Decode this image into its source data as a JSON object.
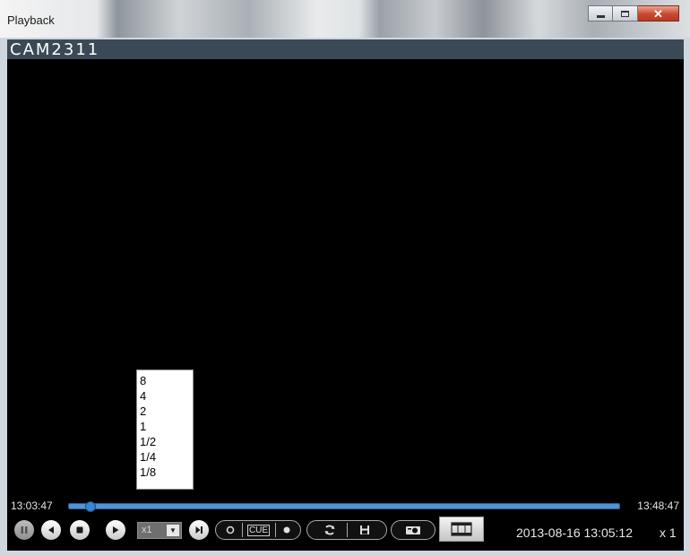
{
  "window": {
    "title": "Playback"
  },
  "camera": {
    "name": "CAM2311"
  },
  "speed_menu": {
    "options": [
      "8",
      "4",
      "2",
      "1",
      "1/2",
      "1/4",
      "1/8"
    ]
  },
  "timeline": {
    "start": "13:03:47",
    "end": "13:48:47",
    "progress": 0.04
  },
  "controls": {
    "speed_value": "x1",
    "cue_label": "CUE",
    "datetime": "2013-08-16 13:05:12",
    "rate": "x 1"
  },
  "icons": {
    "pause": "pause-icon",
    "rewind": "rewind-icon",
    "stop": "stop-icon",
    "play": "play-icon",
    "step": "step-forward-icon",
    "mark_in": "mark-in-icon",
    "mark_out": "mark-out-icon",
    "sync": "sync-icon",
    "save": "save-icon",
    "snapshot": "snapshot-icon",
    "clip": "film-clip-icon"
  },
  "colors": {
    "timeline": "#4f95d6",
    "camera_header": "#3a4955",
    "close_button": "#c9482e"
  }
}
